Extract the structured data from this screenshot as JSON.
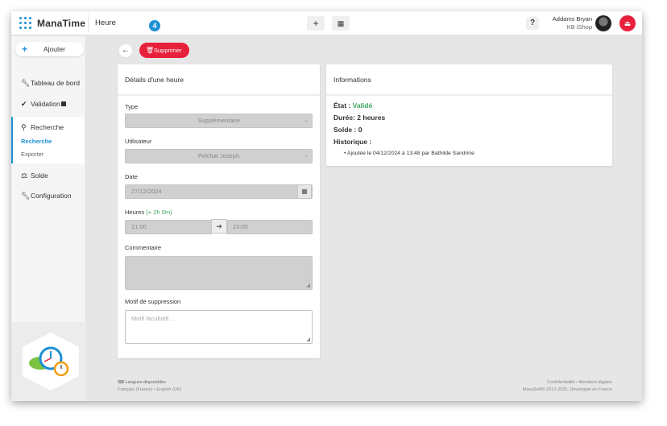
{
  "app": {
    "brand": "ManaTime",
    "breadcrumb": "Heure"
  },
  "topbar": {
    "add_icon": "+",
    "calendar_icon": "▦",
    "help_label": "?",
    "user_name": "Addams Bryan",
    "user_company": "KB iShop",
    "logout_icon": "⏏"
  },
  "step_badge": "4",
  "sidebar": {
    "add_label": "Ajouter",
    "items": [
      {
        "label": "Tableau de bord",
        "icon": "wrench-icon"
      },
      {
        "label": "Validation",
        "icon": "check-icon"
      },
      {
        "label": "Recherche",
        "icon": "search-icon"
      },
      {
        "label": "Solde",
        "icon": "scale-icon"
      },
      {
        "label": "Configuration",
        "icon": "wrench-icon"
      }
    ],
    "subitems": [
      "Recherche",
      "Exporter"
    ]
  },
  "actions": {
    "delete_label": "Supprimer"
  },
  "form": {
    "title": "Détails d'une heure",
    "type_label": "Type",
    "type_value": "Supplémentaire",
    "user_label": "Utilisateur",
    "user_value": "Pelchat Joseph",
    "date_label": "Date",
    "date_value": "27/12/2024",
    "hours_label": "Heures",
    "hours_delta": "(+ 2h 0m)",
    "hours_start": "21:00",
    "hours_end": "23:00",
    "comment_label": "Commentaire",
    "reason_label": "Motif de suppression",
    "reason_placeholder": "Motif facultatif ..."
  },
  "info": {
    "title": "Informations",
    "state_label": "État :",
    "state_value": "Validé",
    "duration": "Durée: 2 heures",
    "balance": "Solde : 0",
    "history_label": "Historique :",
    "history": [
      "Ajoutée le 04/12/2024 à 13:48 par Bathilde Sandrine"
    ]
  },
  "footer": {
    "languages_title": "Langues disponibles",
    "languages": "Français (France) • English (UK)",
    "links": "Confidentialité • Mentions légales",
    "copyright": "ManaSoft® 2012-2025, Développé en France"
  },
  "colors": {
    "accent": "#1e90d6",
    "danger": "#e8203b",
    "success": "#3ca55c"
  }
}
